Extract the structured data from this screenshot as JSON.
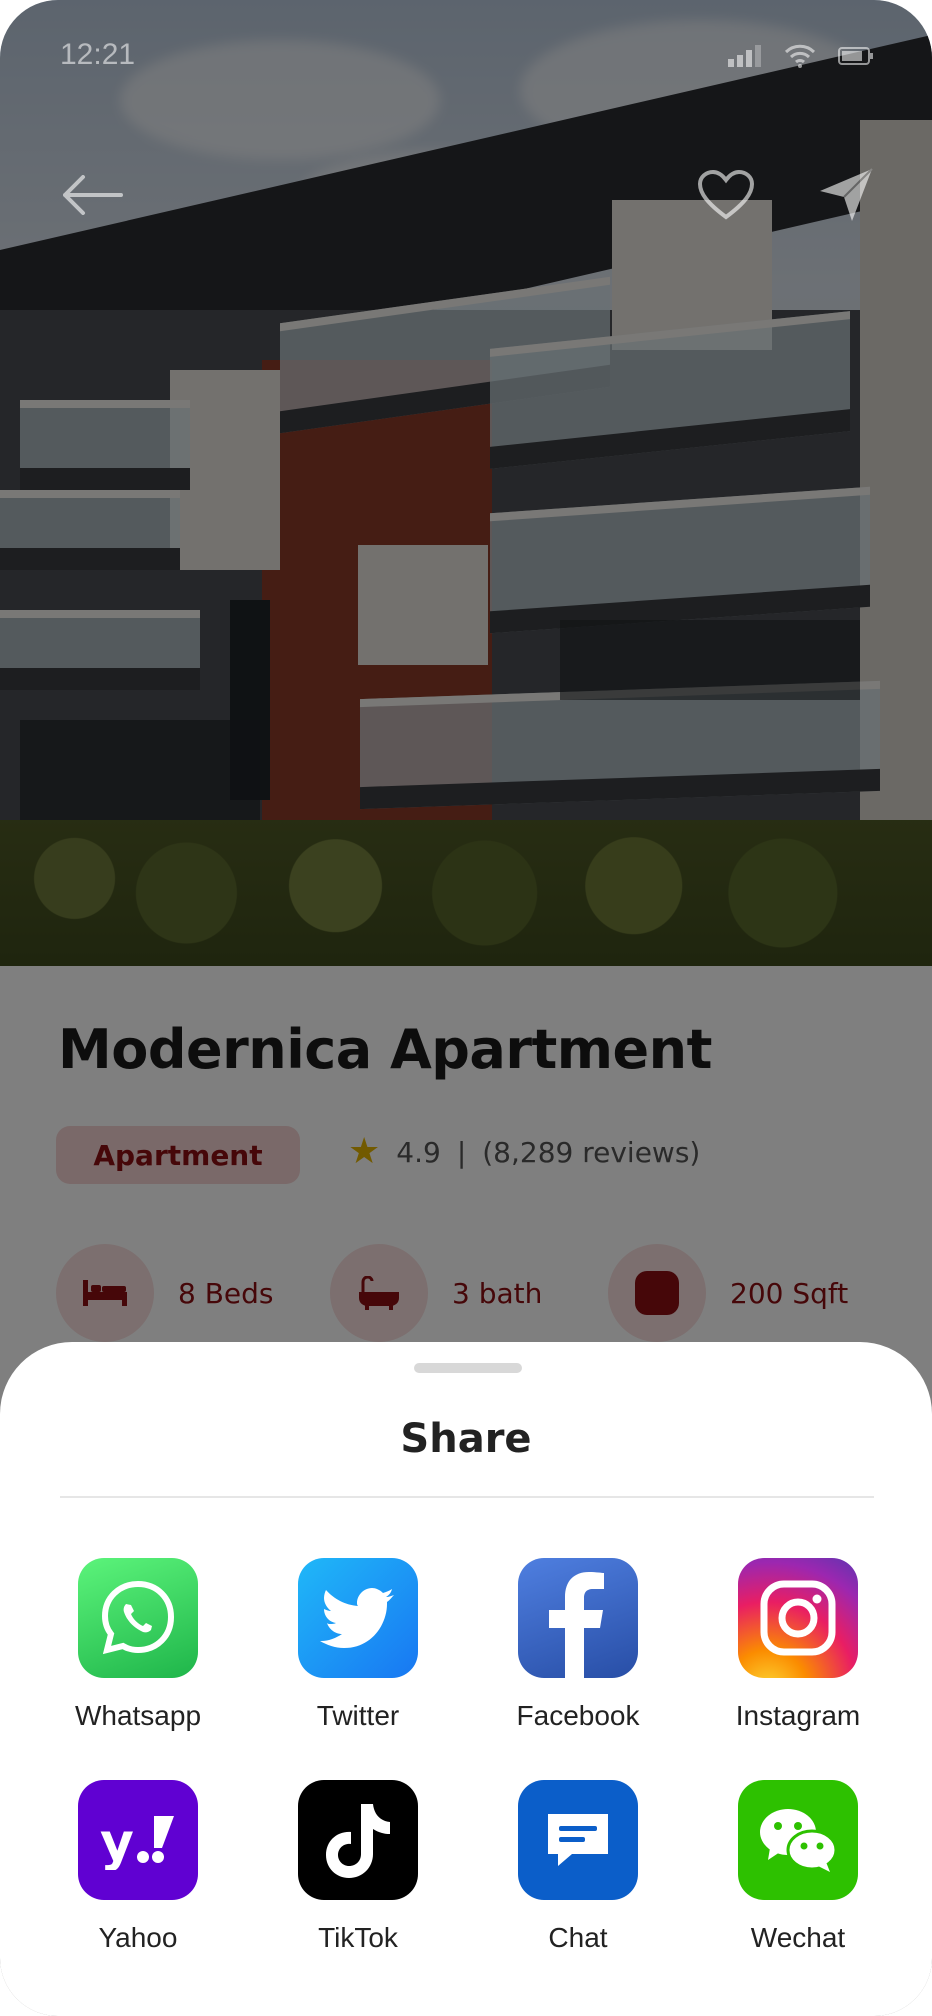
{
  "status_bar": {
    "time": "12:21"
  },
  "property": {
    "title": "Modernica Apartment",
    "category": "Apartment",
    "rating": "4.9",
    "separator": "|",
    "reviews": "(8,289 reviews)"
  },
  "amenities": [
    {
      "icon": "bed-icon",
      "label": "8 Beds"
    },
    {
      "icon": "bathtub-icon",
      "label": "3 bath"
    },
    {
      "icon": "area-icon",
      "label": "200 Sqft"
    }
  ],
  "share_sheet": {
    "title": "Share",
    "apps": [
      {
        "name": "Whatsapp",
        "icon": "whatsapp-icon",
        "color": "#25D366"
      },
      {
        "name": "Twitter",
        "icon": "twitter-icon",
        "color": "#1DA1F2"
      },
      {
        "name": "Facebook",
        "icon": "facebook-icon",
        "color": "#3B5998"
      },
      {
        "name": "Instagram",
        "icon": "instagram-icon",
        "color": "#E1306C"
      },
      {
        "name": "Yahoo",
        "icon": "yahoo-icon",
        "color": "#6001D2"
      },
      {
        "name": "TikTok",
        "icon": "tiktok-icon",
        "color": "#000000"
      },
      {
        "name": "Chat",
        "icon": "chat-icon",
        "color": "#0B5EC9"
      },
      {
        "name": "Wechat",
        "icon": "wechat-icon",
        "color": "#2DC100"
      }
    ]
  },
  "colors": {
    "accent": "#8C0F12",
    "chip_bg": "#F4D2D2",
    "star": "#E5B400"
  }
}
